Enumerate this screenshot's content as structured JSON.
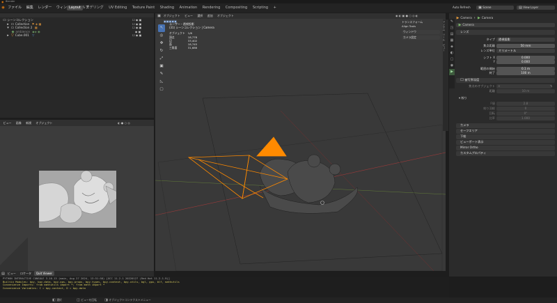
{
  "window": {
    "title": "Blender"
  },
  "topbar": {
    "menus": [
      "ファイル",
      "編集",
      "レンダー",
      "ウィンドウ",
      "ヘルプ"
    ],
    "workspaces": [
      "Layout",
      "モデリング",
      "UV Editing",
      "Texture Paint",
      "Shading",
      "Animation",
      "Rendering",
      "Compositing",
      "Scripting"
    ],
    "active_workspace": "Layout",
    "scene": "Scene",
    "view_layer": "View Layer",
    "auto_refresh": "Auto Refresh"
  },
  "outliner": {
    "rows": [
      {
        "label": "シーンコレクション",
        "indent": 0
      },
      {
        "label": "Collection",
        "indent": 1
      },
      {
        "label": "Collection 2",
        "indent": 1
      },
      {
        "label": "ambience",
        "indent": 2
      },
      {
        "label": "Cube.001",
        "indent": 1
      }
    ]
  },
  "image_editor": {
    "header": [
      "ビュー",
      "画像",
      "新規",
      "オブジェクト"
    ],
    "footer": [
      "ビュー",
      "ロケータ",
      "Quit Viewer"
    ]
  },
  "viewport": {
    "header": [
      "オブジェクト",
      "ビュー",
      "選択",
      "追加",
      "オブジェクト"
    ],
    "overlay_title": "ユーザー・透視投影",
    "overlay_sub": "(31) シーンコレクション | Camera",
    "stats": [
      {
        "label": "オブジェクト",
        "value": "1/6"
      },
      {
        "label": "頂点",
        "value": "18,778"
      },
      {
        "label": "辺",
        "value": "33,402"
      },
      {
        "label": "面",
        "value": "18,745"
      },
      {
        "label": "三角面",
        "value": "31,686"
      }
    ],
    "side_items": [
      "トランスフォーム",
      "Align Tools",
      "ウィンドウ",
      "カメラ設定"
    ],
    "accent_color": "#ff8a00"
  },
  "properties": {
    "object_name": "Camera",
    "data_name": "Camera",
    "section_lens": "レンズ",
    "type_label": "タイプ",
    "type_value": "透視投影",
    "focal_label": "焦点距離",
    "focal_value": "50 mm",
    "lens_unit_label": "レンズ単位",
    "lens_unit_value": "ミリメートル",
    "shift_x_label": "シフト X",
    "shift_x_value": "0.000",
    "shift_y_label": "Y",
    "shift_y_value": "0.000",
    "clip_start_label": "範囲の開始",
    "clip_start_value": "0.1 m",
    "clip_end_label": "終了",
    "clip_end_value": "100 m",
    "dof_label": "被写界深度",
    "focus_object_label": "焦点のオブジェクト",
    "focus_distance_label": "距離",
    "focus_distance_value": "10 m",
    "aperture_label": "絞り",
    "fstop_label": "F値",
    "fstop_value": "2.8",
    "blades_label": "絞り羽根",
    "blades_value": "0",
    "rotation_label": "回転",
    "rotation_value": "0°",
    "ratio_label": "比率",
    "ratio_value": "1.000",
    "panels": [
      "カメラ",
      "セーフエリア",
      "下絵",
      "ビューポート表示",
      "Mirror Ortho",
      "カスタムプロパティ"
    ],
    "tabs": [
      "ツール",
      "レンダー",
      "出力",
      "ビューレイヤー",
      "シーン",
      "ワールド",
      "オブジェクト",
      "物理演算",
      "データ"
    ]
  },
  "console": {
    "lines": [
      "PYTHON INTERACTIVE CONSOLE 3.10.13 (main, Aug 27 2024, 13:51:58) [GCC 11.2.1 20220127 (Red Hat 11.2.1-9)]",
      "Builtin Modules:       bpy, bpy.data, bpy.ops, bpy.props, bpy.types, bpy.context, bpy.utils, bgl, gpu, blf, mathutils",
      "Convenience Imports:   from mathutils import *; from math import *",
      "Convenience Variables: C = bpy.context, D = bpy.data"
    ],
    "status_left": "選択",
    "status_mid": "ビューを回転",
    "status_right": "オブジェクトコンテクストメニュー"
  }
}
